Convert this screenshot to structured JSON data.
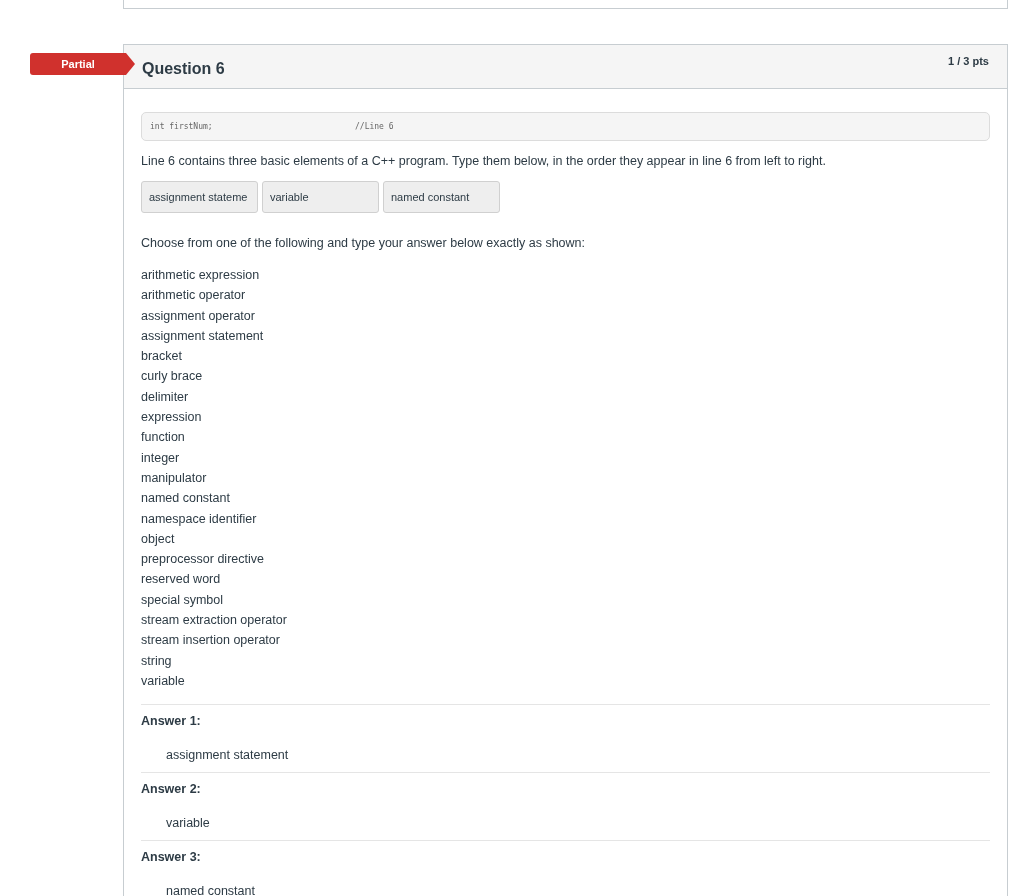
{
  "question": {
    "status": {
      "label": "Partial",
      "kind": "partial"
    },
    "title": "Question 6",
    "points": "1 / 3 pts",
    "code": {
      "statement": "int firstNum;",
      "comment": "//Line 6"
    },
    "prompt": "Line 6 contains three basic elements of a C++ program.  Type them below, in the order they appear in line 6 from left to right.",
    "blanks": [
      {
        "value": "assignment stateme"
      },
      {
        "value": "variable"
      },
      {
        "value": "named constant"
      }
    ],
    "instructions": "Choose from one of the following and type your answer below exactly as shown:",
    "choices": [
      "arithmetic expression",
      "arithmetic operator",
      "assignment operator",
      "assignment statement",
      "bracket",
      "curly brace",
      "delimiter",
      "expression",
      "function",
      "integer",
      "manipulator",
      "named constant",
      "namespace identifier",
      "object",
      "preprocessor directive",
      "reserved word",
      "special symbol",
      "stream extraction operator",
      "stream insertion operator",
      "string",
      "variable"
    ],
    "answers": [
      {
        "label": "Answer 1:",
        "value": "assignment statement"
      },
      {
        "label": "Answer 2:",
        "value": "variable"
      },
      {
        "label": "Answer 3:",
        "value": "named constant"
      }
    ]
  }
}
